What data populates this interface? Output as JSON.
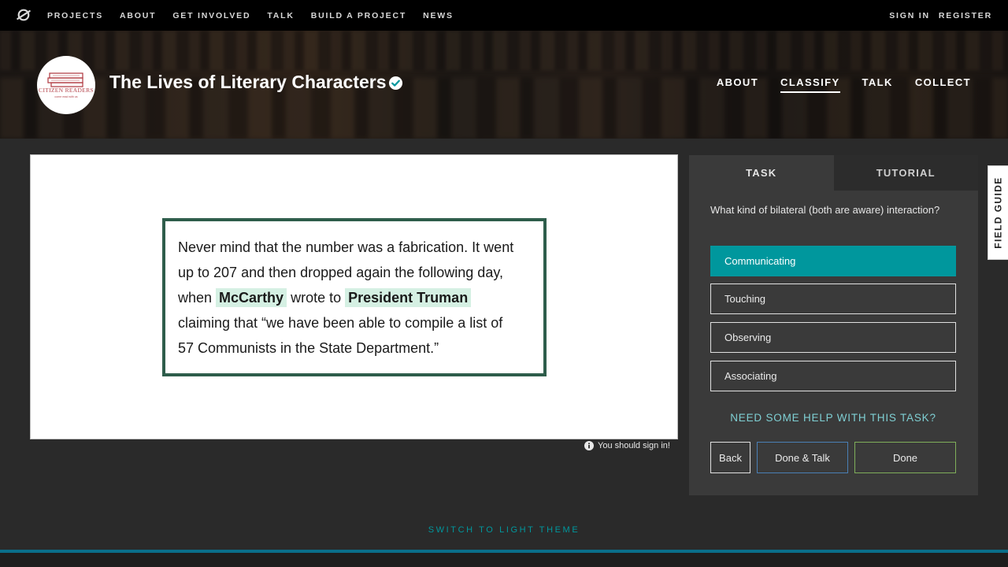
{
  "topnav": {
    "logo_icon": "zooniverse-logo-icon",
    "links": [
      "PROJECTS",
      "ABOUT",
      "GET INVOLVED",
      "TALK",
      "BUILD A PROJECT",
      "NEWS"
    ],
    "sign_in": "SIGN IN",
    "register": "REGISTER"
  },
  "project": {
    "title": "The Lives of Literary Characters",
    "verified_icon": "verified-check-icon",
    "avatar_text": "CITIZEN READERS",
    "avatar_subtext": "come read with us",
    "nav": [
      "ABOUT",
      "CLASSIFY",
      "TALK",
      "COLLECT"
    ],
    "active_nav": "CLASSIFY"
  },
  "subject": {
    "line1": "Never mind that the number was a fabrication. It went",
    "line2": "up to 207 and then dropped again the following day,",
    "line3_pre": "when",
    "entity1": "McCarthy",
    "line3_mid": "wrote to",
    "entity2": "President Truman",
    "line4": "claiming that “we have been able to compile a list of",
    "line5": "57 Communists in the State Department.”",
    "highlight_color": "#d5f0e3",
    "border_color": "#2e5d4b",
    "signin_note": "You should sign in!"
  },
  "task_panel": {
    "tabs": [
      "TASK",
      "TUTORIAL"
    ],
    "active_tab": "TASK",
    "question": "What kind of bilateral (both are aware) interaction?",
    "answers": [
      "Communicating",
      "Touching",
      "Observing",
      "Associating"
    ],
    "selected_answer": "Communicating",
    "help_link": "NEED SOME HELP WITH THIS TASK?",
    "buttons": {
      "back": "Back",
      "done_talk": "Done & Talk",
      "done": "Done"
    },
    "accent_color": "#00979d"
  },
  "field_guide": "FIELD GUIDE",
  "footer": {
    "theme_link": "SWITCH TO LIGHT THEME"
  }
}
